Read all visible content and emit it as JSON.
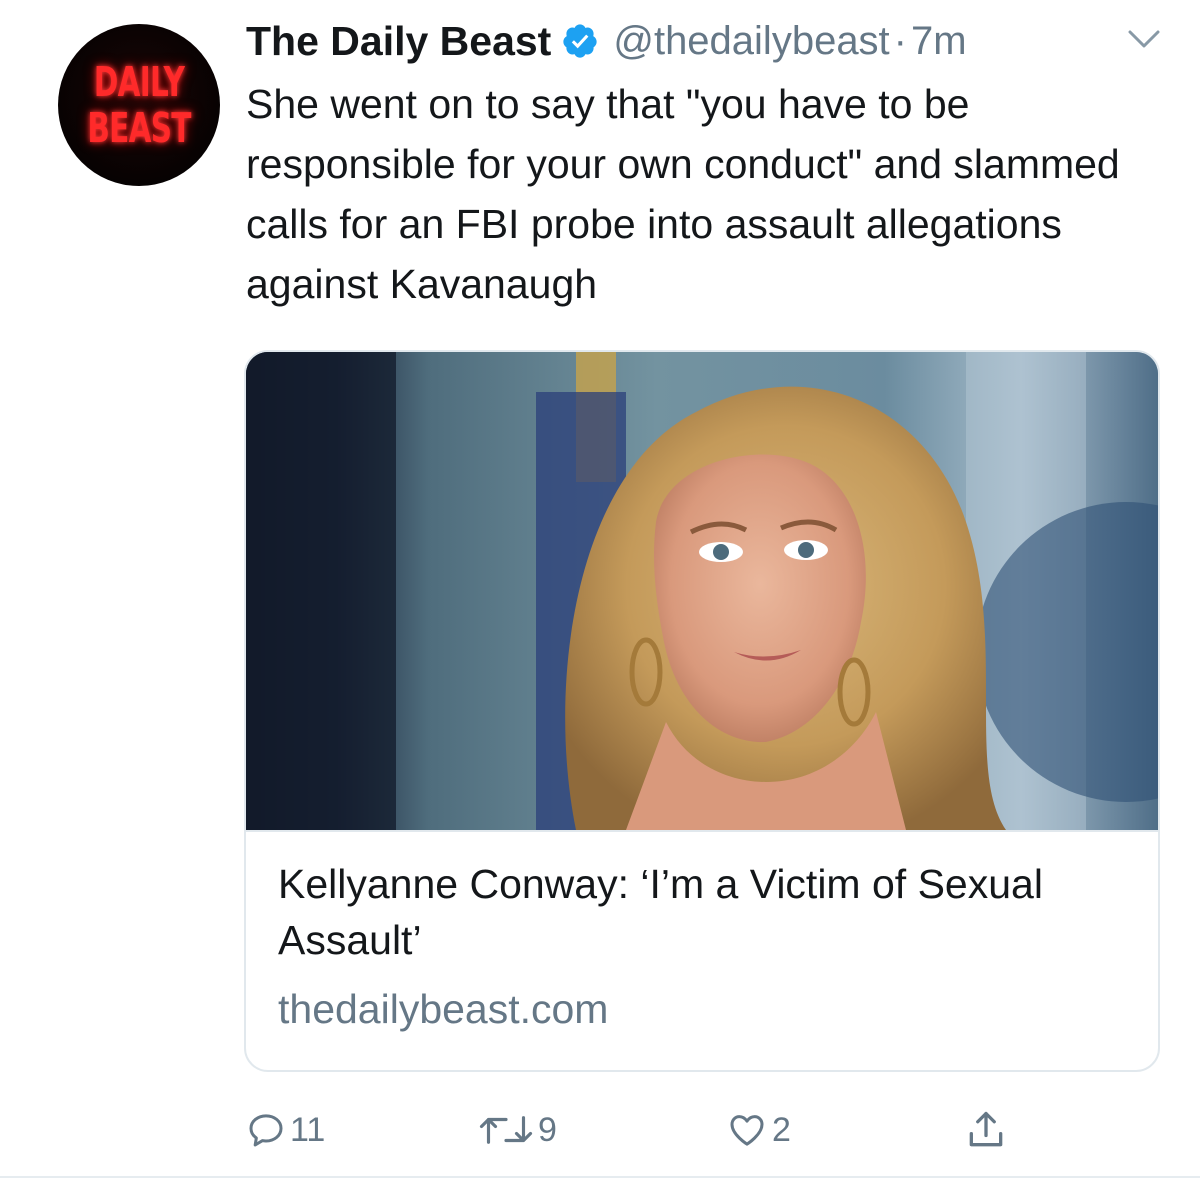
{
  "tweet": {
    "avatar": {
      "logo_line1": "DAILY",
      "logo_line2": "BEAST"
    },
    "display_name": "The Daily Beast",
    "verified": true,
    "handle": "@thedailybeast",
    "separator": "·",
    "time": "7m",
    "text": "She went on to say that \"you have to be responsible for your own conduct\" and slammed calls for an FBI probe into assault allegations against Kavanaugh",
    "card": {
      "title": "Kellyanne Conway: ‘I’m a Victim of Sexual Assault’",
      "domain": "thedailybeast.com"
    },
    "actions": {
      "replies": "11",
      "retweets": "9",
      "likes": "2"
    }
  },
  "colors": {
    "verified_blue": "#1da1f2",
    "secondary_text": "#657786",
    "primary_text": "#14171a",
    "logo_red": "#ff2a2a"
  },
  "icons": [
    "verified-badge-icon",
    "chevron-down-icon",
    "reply-icon",
    "retweet-icon",
    "heart-icon",
    "share-icon"
  ]
}
